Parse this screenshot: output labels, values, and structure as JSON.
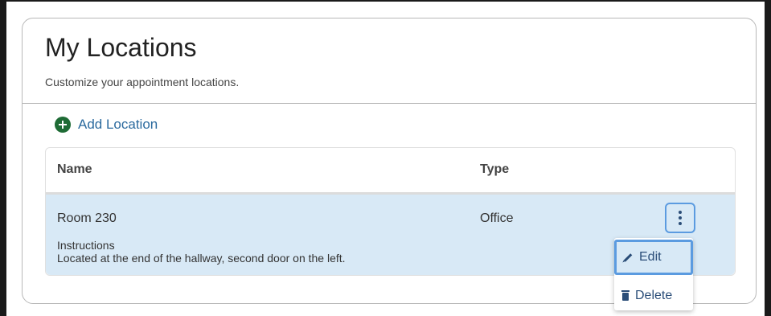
{
  "page": {
    "title": "My Locations",
    "subtitle": "Customize your appointment locations."
  },
  "actions": {
    "add_label": "Add Location"
  },
  "table": {
    "columns": [
      "Name",
      "Type"
    ],
    "rows": [
      {
        "name": "Room 230",
        "type": "Office",
        "instructions_label": "Instructions",
        "instructions_text": "Located at the end of the hallway, second door on the left."
      }
    ]
  },
  "row_menu": {
    "items": [
      "Edit",
      "Delete"
    ]
  },
  "icons": {
    "add": "plus-circle-icon",
    "more": "kebab-menu-icon",
    "edit": "pencil-icon",
    "delete": "trash-icon"
  },
  "colors": {
    "accent_green": "#1e6b35",
    "link_blue": "#2b6a9e",
    "row_highlight": "#d8e9f6",
    "focus_ring": "#5b9be0"
  }
}
